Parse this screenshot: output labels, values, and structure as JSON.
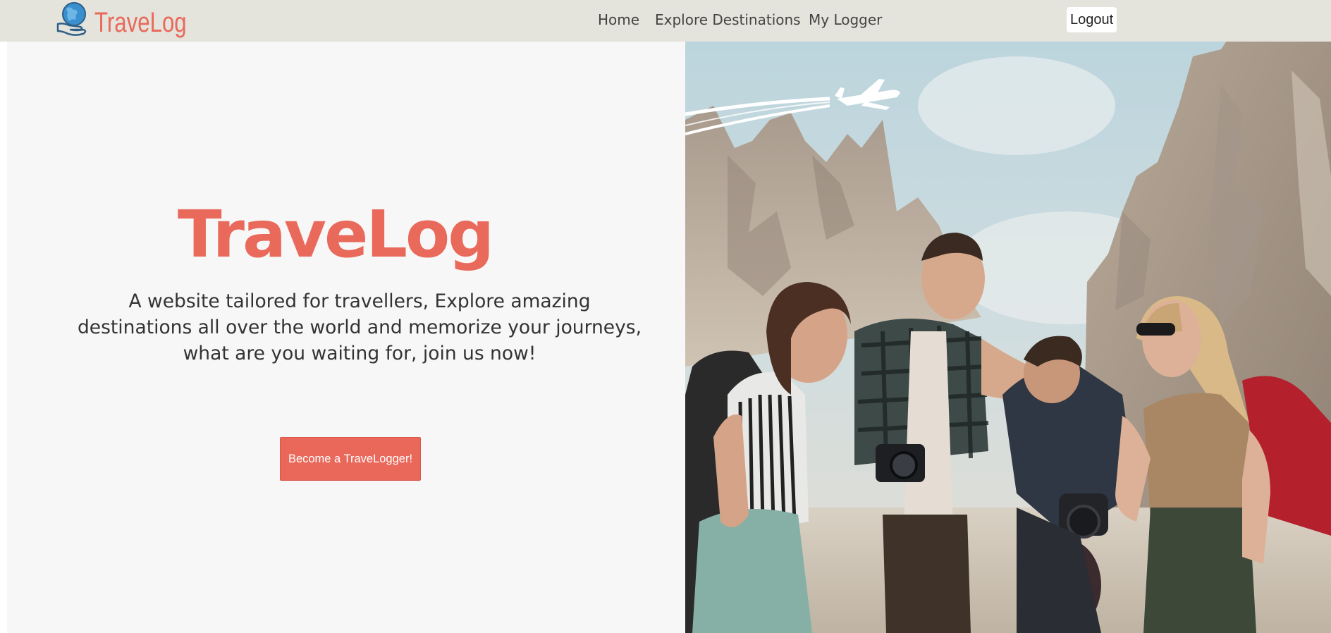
{
  "navbar": {
    "brand_text": "TraveLog",
    "brand_icon": "globe-hand-logo-icon",
    "links": [
      {
        "label": "Home"
      },
      {
        "label": "Explore Destinations"
      },
      {
        "label": "My Logger"
      }
    ],
    "logout_label": "Logout"
  },
  "hero": {
    "title": "TraveLog",
    "description": "A website tailored for travellers, Explore amazing destinations all over the world and memorize your journeys, what are you waiting for, join us now!",
    "cta_label": "Become a TraveLogger!"
  },
  "image": {
    "subject": "travel-friends-mountains-photo",
    "plane_icon": "airplane-icon"
  },
  "colors": {
    "accent": "#e9695b",
    "navbar_bg": "#e4e3dc",
    "panel_bg": "#f7f7f7",
    "text": "#333333"
  }
}
